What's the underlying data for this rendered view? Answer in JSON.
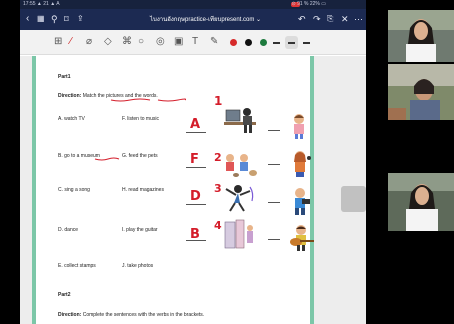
{
  "status": {
    "time": "17:55  ▲ 21 ▲ A",
    "right": "⊙ 91 % 22% ▭"
  },
  "app": {
    "title": "ไบงานอังกฤษpractice-เทียบpresent.com ⌄"
  },
  "worksheet": {
    "part1_title": "Part1",
    "direction_label": "Direction:",
    "direction_text": " Match the pictures and the words.",
    "options_left": [
      "A. watch TV",
      "B. go to a museum",
      "C. sing a song",
      "D. dance",
      "E. collect stamps"
    ],
    "options_right": [
      "F. listen to music",
      "G. feed the pets",
      "H. read magazines",
      "I. play the guitar",
      "J. take photos"
    ],
    "answers": [
      "A",
      "F",
      "D",
      "B"
    ],
    "numbers": [
      "1",
      "2",
      "3",
      "4"
    ],
    "part2_title": "Part2",
    "part2_direction_label": "Direction:",
    "part2_direction_text": " Complete the sentences with the verbs in the brackets."
  },
  "colors": {
    "ink": "#d41d2a",
    "border": "#7cc7a8",
    "topbar": "#1c2a52"
  },
  "icons": [
    "chevron-left-icon",
    "grid-icon",
    "search-icon",
    "bookmark-icon",
    "share-icon",
    "undo-icon",
    "redo-icon",
    "export-icon",
    "close-icon",
    "more-icon"
  ]
}
